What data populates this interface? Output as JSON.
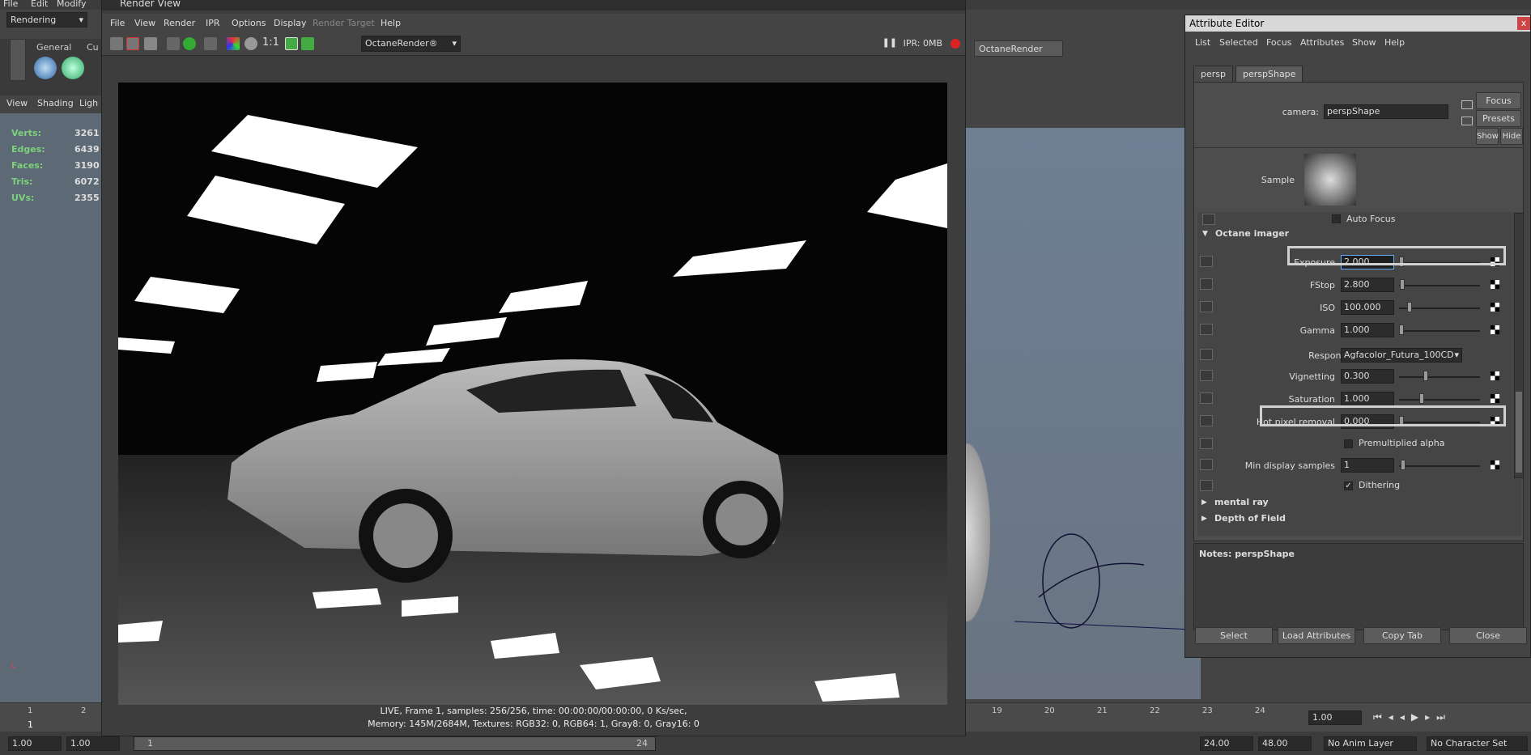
{
  "maya": {
    "menu": [
      "File",
      "Edit",
      "Modify"
    ],
    "mode": "Rendering",
    "shelf_tabs": [
      "General",
      "Cu"
    ],
    "panel_menu": [
      "View",
      "Shading",
      "Ligh"
    ],
    "hud": [
      {
        "label": "Verts:",
        "value": "3261"
      },
      {
        "label": "Edges:",
        "value": "6439"
      },
      {
        "label": "Faces:",
        "value": "3190"
      },
      {
        "label": "Tris:",
        "value": "6072"
      },
      {
        "label": "UVs:",
        "value": "2355"
      }
    ],
    "timeline_ticks": [
      "1",
      "2",
      "19",
      "20",
      "21",
      "22",
      "23",
      "24"
    ],
    "frame_label": "1",
    "current_time": "1.00",
    "range": {
      "start": "1.00",
      "start2": "1.00",
      "slider_start": "1",
      "slider_end": "24",
      "end": "24.00",
      "end2": "48.00"
    },
    "anim_layer": "No Anim Layer",
    "char_set": "No Character Set",
    "octane_tab": "OctaneRender"
  },
  "render_view": {
    "title": "Render View",
    "menu": [
      "File",
      "View",
      "Render",
      "IPR",
      "Options",
      "Display",
      "Render Target",
      "Help"
    ],
    "ratio": "1:1",
    "renderer": "OctaneRender®",
    "ipr": "IPR: 0MB",
    "status_line1": "LIVE, Frame 1, samples: 256/256, time: 00:00:00/00:00:00, 0 Ks/sec,",
    "status_line2": "Memory: 145M/2684M, Textures: RGB32: 0, RGB64: 1, Gray8: 0, Gray16: 0"
  },
  "attribute_editor": {
    "title": "Attribute Editor",
    "close": "x",
    "menu": [
      "List",
      "Selected",
      "Focus",
      "Attributes",
      "Show",
      "Help"
    ],
    "tabs": [
      "persp",
      "perspShape"
    ],
    "camera_label": "camera:",
    "camera_value": "perspShape",
    "focus_btn": "Focus",
    "presets_btn": "Presets",
    "show_btn": "Show",
    "hide_btn": "Hide",
    "sample_label": "Sample",
    "auto_focus": "Auto Focus",
    "section_imager": "Octane imager",
    "rows": [
      {
        "label": "Exposure",
        "value": "2.000",
        "knob": 0.0
      },
      {
        "label": "FStop",
        "value": "2.800",
        "knob": 0.01
      },
      {
        "label": "ISO",
        "value": "100.000",
        "knob": 0.1
      },
      {
        "label": "Gamma",
        "value": "1.000",
        "knob": 0.0
      },
      {
        "label": "Vignetting",
        "value": "0.300",
        "knob": 0.3
      },
      {
        "label": "Saturation",
        "value": "1.000",
        "knob": 0.25
      },
      {
        "label": "Hot pixel removal",
        "value": "0.000",
        "knob": 0.0
      }
    ],
    "response_label": "Response",
    "response_value": "Agfacolor_Futura_100CD",
    "premult": "Premultiplied alpha",
    "min_display_label": "Min display samples",
    "min_display_value": "1",
    "dithering": "Dithering",
    "section_mental": "mental ray",
    "section_dof": "Depth of Field",
    "notes": "Notes:  perspShape",
    "buttons": [
      "Select",
      "Load Attributes",
      "Copy Tab",
      "Close"
    ]
  }
}
